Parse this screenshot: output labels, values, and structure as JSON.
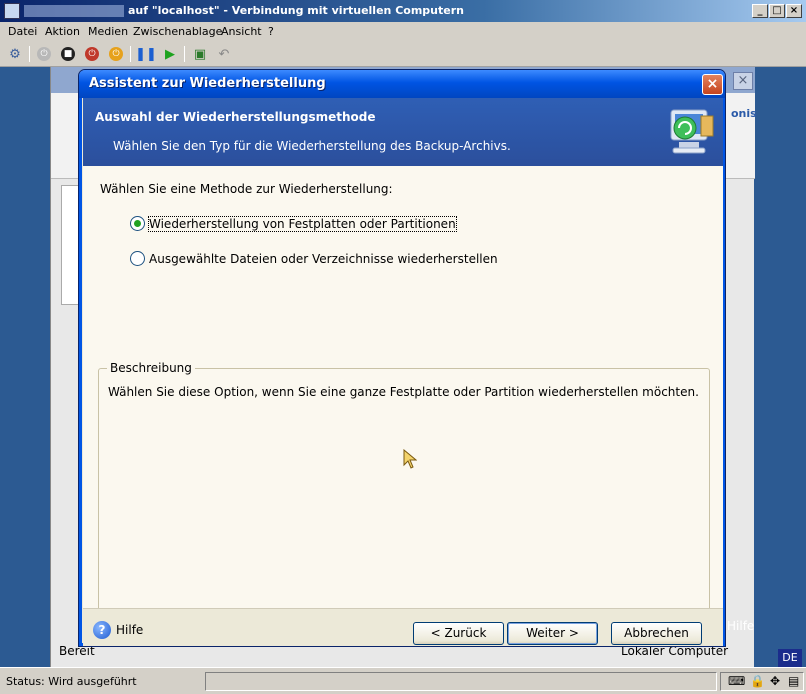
{
  "window": {
    "title": "auf \"localhost\" - Verbindung mit virtuellen Computern",
    "controls": {
      "minimize": "_",
      "maximize": "□",
      "close": "×"
    }
  },
  "menu": [
    "Datei",
    "Aktion",
    "Medien",
    "Zwischenablage",
    "Ansicht",
    "?"
  ],
  "toolbar_icons": [
    "ctrl-alt-del-icon",
    "start-icon",
    "stop-icon",
    "shutdown-icon",
    "power-icon",
    "pause-icon",
    "resume-icon",
    "checkpoint-icon",
    "revert-icon"
  ],
  "background_app": {
    "brand": "onis",
    "footer_left": "Bereit",
    "footer_right": "Lokaler Computer",
    "help_text": "Hilfe",
    "close_glyph": "×"
  },
  "dialog": {
    "title": "Assistent zur Wiederherstellung",
    "close_glyph": "×",
    "header_title": "Auswahl der Wiederherstellungsmethode",
    "header_subtitle": "Wählen Sie den Typ für die Wiederherstellung des Backup-Archivs.",
    "prompt": "Wählen Sie eine Methode zur Wiederherstellung:",
    "options": [
      {
        "label": "Wiederherstellung von Festplatten oder Partitionen",
        "selected": true
      },
      {
        "label": "Ausgewählte Dateien oder Verzeichnisse wiederherstellen",
        "selected": false
      }
    ],
    "description_title": "Beschreibung",
    "description_text": "Wählen Sie diese Option, wenn Sie eine ganze Festplatte oder Partition wiederherstellen möchten.",
    "help_label": "Hilfe",
    "buttons": {
      "back": "< Zurück",
      "next": "Weiter >",
      "cancel": "Abbrechen"
    }
  },
  "language_badge": "DE",
  "status": {
    "text": "Status: Wird ausgeführt"
  },
  "colors": {
    "dialog_title": "#0054e3",
    "header": "#2f5fb5",
    "vm_background": "#3a6ea5",
    "radio_selected": "#21a121"
  }
}
